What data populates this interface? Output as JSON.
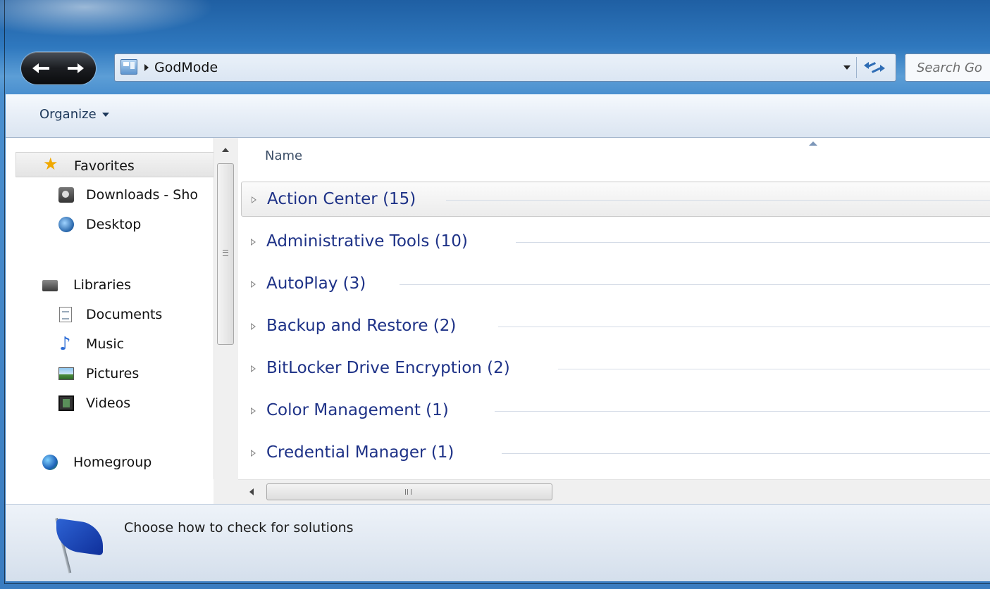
{
  "address": {
    "crumbs": [
      "GodMode"
    ],
    "search_placeholder": "Search Go"
  },
  "toolbar": {
    "organize_label": "Organize"
  },
  "navigation": {
    "favorites": {
      "label": "Favorites",
      "items": [
        {
          "label": "Downloads - Sho",
          "icon": "downloads-icon"
        },
        {
          "label": "Desktop",
          "icon": "desktop-icon"
        }
      ]
    },
    "libraries": {
      "label": "Libraries",
      "items": [
        {
          "label": "Documents",
          "icon": "documents-icon"
        },
        {
          "label": "Music",
          "icon": "music-icon"
        },
        {
          "label": "Pictures",
          "icon": "pictures-icon"
        },
        {
          "label": "Videos",
          "icon": "videos-icon"
        }
      ]
    },
    "homegroup": {
      "label": "Homegroup",
      "icon": "homegroup-icon"
    }
  },
  "content": {
    "column_header": "Name",
    "groups": [
      {
        "label": "Action Center (15)",
        "selected": true
      },
      {
        "label": "Administrative Tools (10)"
      },
      {
        "label": "AutoPlay (3)"
      },
      {
        "label": "Backup and Restore (2)"
      },
      {
        "label": "BitLocker Drive Encryption (2)"
      },
      {
        "label": "Color Management (1)"
      },
      {
        "label": "Credential Manager (1)"
      }
    ]
  },
  "details": {
    "text": "Choose how to check for solutions",
    "icon": "flag-icon"
  },
  "colors": {
    "group_text": "#1e3287",
    "frame": "#3a7cc0",
    "toolbar_text": "#1e395b"
  }
}
